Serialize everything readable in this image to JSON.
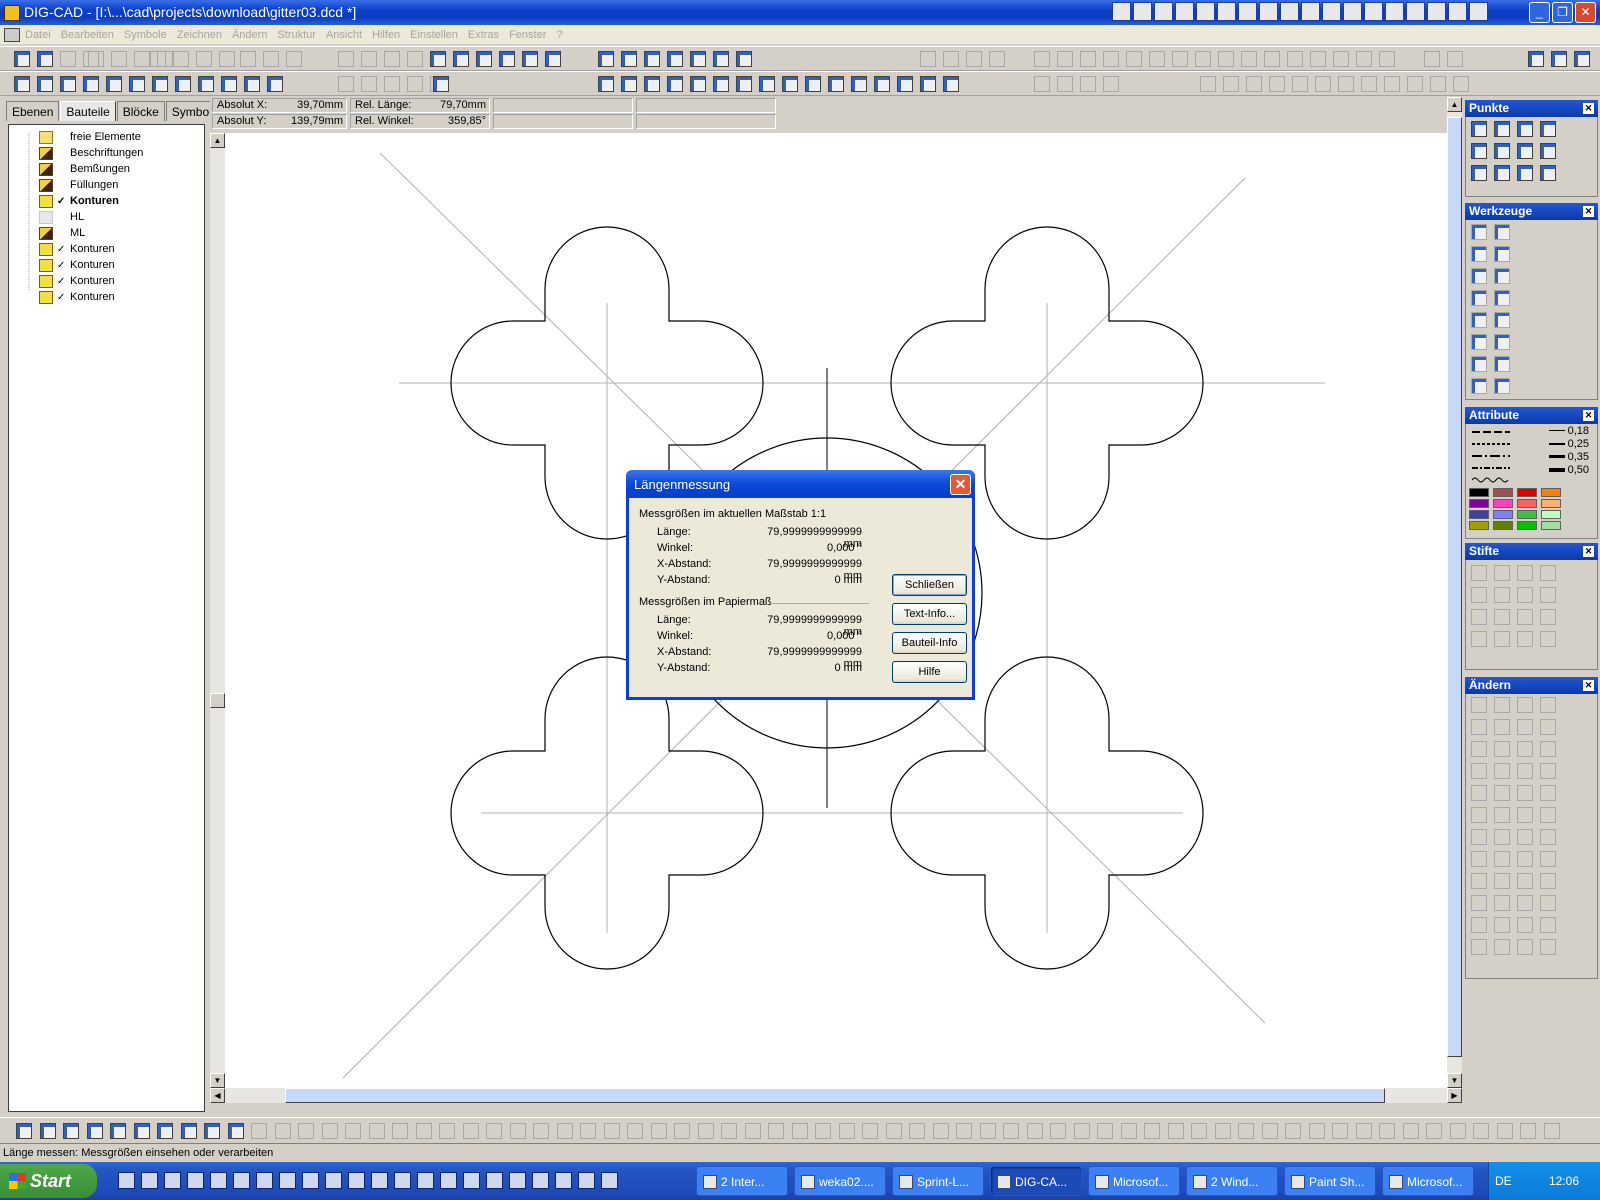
{
  "window": {
    "title": "DIG-CAD - [I:\\...\\cad\\projects\\download\\gitter03.dcd *]"
  },
  "menu": [
    "Datei",
    "Bearbeiten",
    "Symbole",
    "Zeichnen",
    "Ändern",
    "Struktur",
    "Ansicht",
    "Hilfen",
    "Einstellen",
    "Extras",
    "Fenster",
    "?"
  ],
  "left_panel": {
    "tabs": [
      "Ebenen",
      "Bauteile",
      "Blöcke",
      "Symbole"
    ],
    "active_tab": "Bauteile",
    "tree": [
      {
        "label": "freie Elemente",
        "icon": "folder-icon"
      },
      {
        "label": "Beschriftungen",
        "icon": "hammer-icon"
      },
      {
        "label": "Bemßungen",
        "icon": "hammer-icon"
      },
      {
        "label": "Füllungen",
        "icon": "hammer-icon"
      },
      {
        "label": "Konturen",
        "icon": "cube-icon",
        "bold": true
      },
      {
        "label": "HL",
        "icon": "hammer-faded-icon"
      },
      {
        "label": "ML",
        "icon": "hammer-icon"
      },
      {
        "label": "Konturen",
        "icon": "cube-icon"
      },
      {
        "label": "Konturen",
        "icon": "cube-icon"
      },
      {
        "label": "Konturen",
        "icon": "cube-icon"
      },
      {
        "label": "Konturen",
        "icon": "cube-icon"
      }
    ]
  },
  "coords": {
    "abs_x_label": "Absolut X:",
    "abs_x": "39,70mm",
    "abs_y_label": "Absolut Y:",
    "abs_y": "139,79mm",
    "rel_len_label": "Rel. Länge:",
    "rel_len": "79,70mm",
    "rel_angle_label": "Rel. Winkel:",
    "rel_angle": "359,85°"
  },
  "palettes": {
    "punkte": "Punkte",
    "werkzeuge": "Werkzeuge",
    "attribute": "Attribute",
    "stifte": "Stifte",
    "aendern": "Ändern",
    "line_widths": [
      "0,18",
      "0,25",
      "0,35",
      "0,50"
    ],
    "swatches": [
      "#000000",
      "#a05050",
      "#e00000",
      "#ff8000",
      "#8000a0",
      "#ff40c0",
      "#ff6060",
      "#ffb070",
      "#4040a0",
      "#8080ff",
      "#40c040",
      "#c0ffc0",
      "#a0a000",
      "#608000",
      "#00c000",
      "#a0e0a0"
    ]
  },
  "dialog": {
    "title": "Längenmessung",
    "group1": "Messgrößen im aktuellen Maßstab 1:1",
    "group2": "Messgrößen im Papiermaß",
    "rows1": [
      {
        "label": "Länge:",
        "value": "79,9999999999999 mm"
      },
      {
        "label": "Winkel:",
        "value": "0,000 °"
      },
      {
        "label": "X-Abstand:",
        "value": "79,9999999999999 mm"
      },
      {
        "label": "Y-Abstand:",
        "value": "0 mm"
      }
    ],
    "rows2": [
      {
        "label": "Länge:",
        "value": "79,9999999999999 mm"
      },
      {
        "label": "Winkel:",
        "value": "0,000 °"
      },
      {
        "label": "X-Abstand:",
        "value": "79,9999999999999 mm"
      },
      {
        "label": "Y-Abstand:",
        "value": "0 mm"
      }
    ],
    "buttons": [
      "Schließen",
      "Text-Info...",
      "Bauteil-Info",
      "Hilfe"
    ]
  },
  "status": "Länge messen: Messgrößen einsehen oder verarbeiten",
  "taskbar": {
    "start": "Start",
    "tasks": [
      "2 Inter...",
      "weka02....",
      "Sprint-L...",
      "DIG-CA...",
      "Microsof...",
      "2 Wind...",
      "Paint Sh...",
      "Microsof..."
    ],
    "active_task": "DIG-CA...",
    "lang": "DE",
    "clock": "12:06"
  }
}
